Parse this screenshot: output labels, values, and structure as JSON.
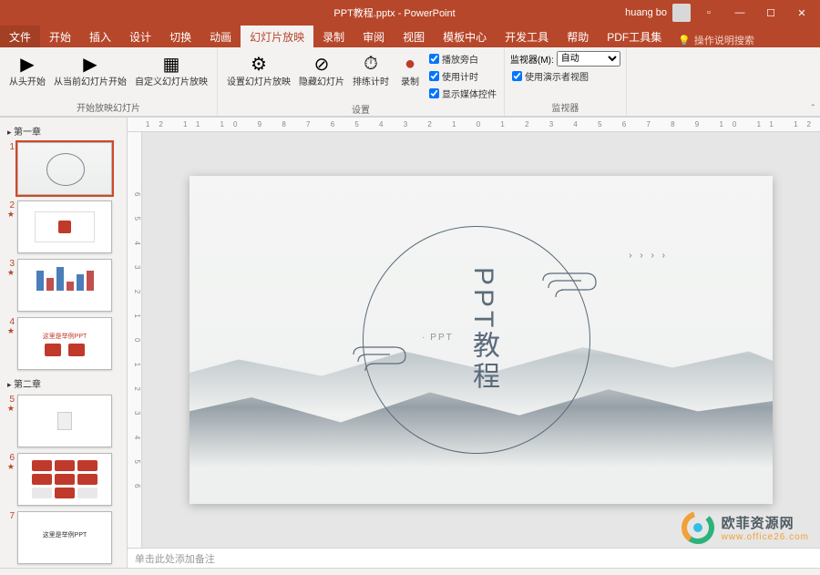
{
  "titlebar": {
    "doc_title": "PPT教程.pptx - PowerPoint",
    "user": "huang bo"
  },
  "tabs": {
    "file": "文件",
    "items": [
      "开始",
      "插入",
      "设计",
      "切换",
      "动画",
      "幻灯片放映",
      "录制",
      "审阅",
      "视图",
      "模板中心",
      "开发工具",
      "帮助",
      "PDF工具集"
    ],
    "active_index": 5,
    "tell_me": "操作说明搜索"
  },
  "ribbon": {
    "group_start": {
      "from_beginning": "从头开始",
      "from_current": "从当前幻灯片开始",
      "label": "开始放映幻灯片"
    },
    "group_custom": {
      "custom_show": "自定义幻灯片放映",
      "label": ""
    },
    "group_setup": {
      "setup": "设置幻灯片放映",
      "hide": "隐藏幻灯片",
      "rehearse": "排练计时",
      "record": "录制",
      "check_narration": "播放旁白",
      "check_timings": "使用计时",
      "check_media": "显示媒体控件",
      "label": "设置"
    },
    "group_monitor": {
      "monitor_label": "监视器(M):",
      "monitor_value": "自动",
      "use_presenter": "使用演示者视图",
      "label": "监视器"
    }
  },
  "sections": {
    "s1": "第一章",
    "s2": "第二章"
  },
  "thumbs": {
    "t4_title": "这里是举例PPT",
    "t7_title": "这里是举例PPT"
  },
  "slide": {
    "title": "PPT教程",
    "subtitle": "PPT"
  },
  "ruler_h": "12 11 10 9 8 7 6 5 4 3 2 1 0 1 2 3 4 5 6 7 8 9 10 11 12",
  "ruler_v": "6 5 4 3 2 1 0 1 2 3 4 5 6",
  "notes": "单击此处添加备注",
  "watermark": {
    "cn": "欧菲资源网",
    "url": "www.office26.com"
  }
}
